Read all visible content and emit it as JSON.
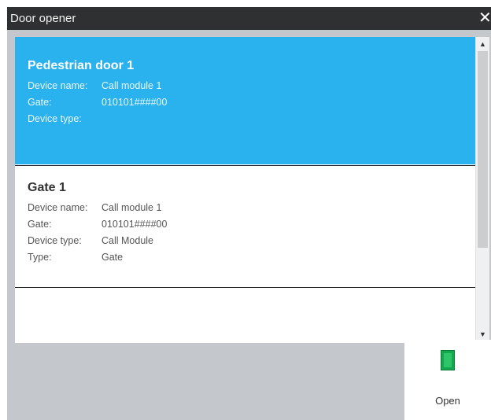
{
  "window": {
    "title": "Door opener",
    "close_glyph": "✕"
  },
  "list": {
    "items": [
      {
        "name": "Pedestrian door 1",
        "selected": true,
        "fields": [
          {
            "label": "Device name:",
            "value": "Call module 1"
          },
          {
            "label": "Gate:",
            "value": "010101####00"
          },
          {
            "label": "Device type:",
            "value": ""
          }
        ]
      },
      {
        "name": "Gate 1",
        "selected": false,
        "fields": [
          {
            "label": "Device name:",
            "value": "Call module 1"
          },
          {
            "label": "Gate:",
            "value": "010101####00"
          },
          {
            "label": "Device type:",
            "value": "Call Module"
          },
          {
            "label": "Type:",
            "value": "Gate"
          }
        ]
      }
    ]
  },
  "scrollbar": {
    "up_glyph": "▲",
    "down_glyph": "▼"
  },
  "actions": {
    "open_label": "Open",
    "open_icon": "door-icon"
  },
  "colors": {
    "selected_bg": "#2ab2ef",
    "titlebar_bg": "#2f3032",
    "door_green": "#11a84e"
  }
}
